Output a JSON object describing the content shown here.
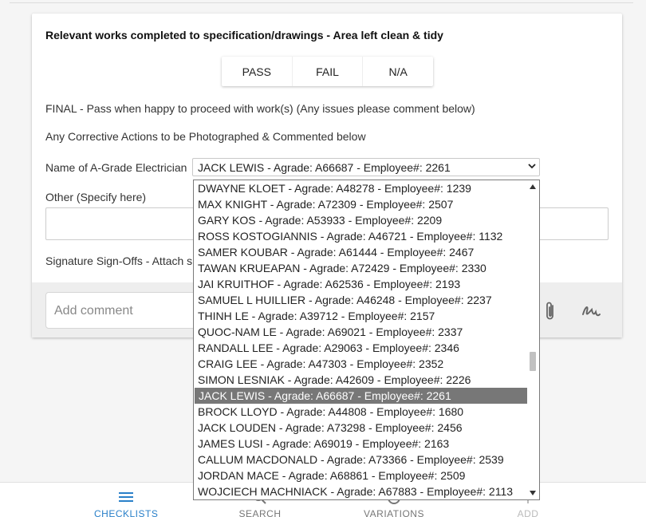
{
  "card": {
    "title": "Relevant works completed to specification/drawings - Area left clean & tidy",
    "options": [
      "PASS",
      "FAIL",
      "N/A"
    ],
    "final_text": "FINAL - Pass when happy to proceed with work(s) (Any issues please comment below)",
    "corrective_text": "Any Corrective Actions to be Photographed & Commented below",
    "electrician_label": "Name of A-Grade Electrician",
    "electrician_value": "JACK LEWIS - Agrade: A66687 - Employee#: 2261",
    "other_label": "Other (Specify here)",
    "signature_label": "Signature Sign-Offs - Attach s",
    "comment_placeholder": "Add comment"
  },
  "dropdown": {
    "selected_index": 13,
    "items": [
      "DWAYNE KLOET - Agrade: A48278 - Employee#: 1239",
      "MAX KNIGHT - Agrade: A72309 - Employee#: 2507",
      "GARY KOS - Agrade: A53933 - Employee#: 2209",
      "ROSS KOSTOGIANNIS - Agrade: A46721 - Employee#: 1132",
      "SAMER KOUBAR - Agrade: A61444 - Employee#: 2467",
      "TAWAN KRUEAPAN - Agrade: A72429 - Employee#: 2330",
      "JAI KRUITHOF - Agrade: A62536 - Employee#: 2193",
      "SAMUEL L HUILLIER - Agrade: A46248 - Employee#: 2237",
      "THINH LE - Agrade: A39712 - Employee#: 2157",
      "QUOC-NAM LE - Agrade: A69021 - Employee#: 2337",
      "RANDALL LEE - Agrade: A29063 - Employee#: 2346",
      "CRAIG LEE - Agrade: A47303 - Employee#: 2352",
      "SIMON LESNIAK - Agrade: A42609 - Employee#: 2226",
      "JACK LEWIS - Agrade: A66687 - Employee#: 2261",
      "BROCK LLOYD - Agrade: A44808 - Employee#: 1680",
      "JACK LOUDEN - Agrade: A73298 - Employee#: 2456",
      "JAMES LUSI - Agrade: A69019 - Employee#: 2163",
      "CALLUM MACDONALD - Agrade: A73366 - Employee#: 2539",
      "JORDAN MACE - Agrade: A68861 - Employee#: 2509",
      "WOJCIECH MACHNIACK - Agrade: A67883 - Employee#: 2113"
    ]
  },
  "nav": {
    "items": [
      {
        "label": "CHECKLISTS",
        "icon": "list-icon"
      },
      {
        "label": "SEARCH",
        "icon": "search-icon"
      },
      {
        "label": "VARIATIONS",
        "icon": "variations-icon"
      },
      {
        "label": "ADD",
        "icon": "add-icon"
      }
    ]
  },
  "colors": {
    "accent": "#2a80c9",
    "selected_bg": "#777777",
    "comment_bar": "#eeeeee"
  }
}
